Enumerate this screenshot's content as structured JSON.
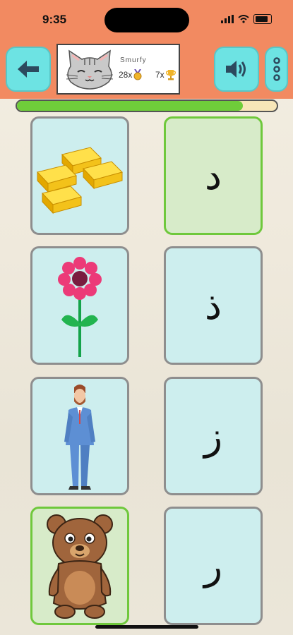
{
  "status_bar": {
    "time": "9:35"
  },
  "header": {
    "back_icon": "arrow-left-icon",
    "sound_icon": "speaker-icon",
    "menu_icon": "vertical-dots-icon",
    "profile": {
      "name": "Smurfy",
      "avatar": "cat-face-avatar",
      "medals": "28x",
      "trophies": "7x"
    }
  },
  "progress": {
    "value": 0.87
  },
  "picture_cards": [
    {
      "name": "gold-bars-card",
      "icon": "gold-bars",
      "selected": false
    },
    {
      "name": "flower-card",
      "icon": "flower",
      "selected": false
    },
    {
      "name": "man-card",
      "icon": "man-in-suit",
      "selected": false
    },
    {
      "name": "bear-card",
      "icon": "bear",
      "selected": true
    }
  ],
  "letter_cards": [
    {
      "letter": "د",
      "selected": true
    },
    {
      "letter": "ذ",
      "selected": false
    },
    {
      "letter": "ز",
      "selected": false
    },
    {
      "letter": "ر",
      "selected": false
    }
  ],
  "colors": {
    "header_bg": "#f28a61",
    "button": "#6de3e3",
    "card_bg": "#cdeeee",
    "selected_border": "#6fc83c",
    "progress_fill": "#6fcd3a"
  }
}
